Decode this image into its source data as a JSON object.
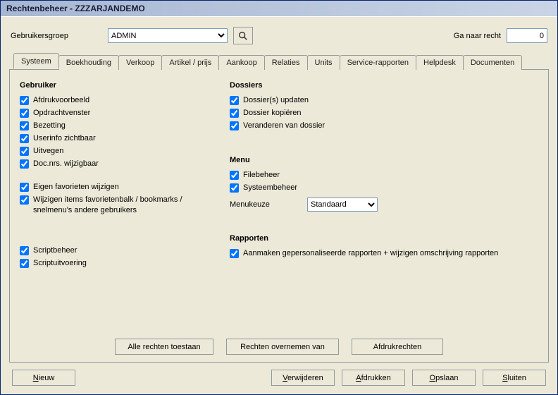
{
  "window": {
    "title": "Rechtenbeheer   -   ZZZARJANDEMO"
  },
  "toolbar": {
    "group_label": "Gebruikersgroep",
    "group_value": "ADMIN",
    "goto_label": "Ga naar recht",
    "goto_value": "0"
  },
  "tabs": [
    {
      "label": "Systeem",
      "active": true
    },
    {
      "label": "Boekhouding"
    },
    {
      "label": "Verkoop"
    },
    {
      "label": "Artikel / prijs"
    },
    {
      "label": "Aankoop"
    },
    {
      "label": "Relaties"
    },
    {
      "label": "Units"
    },
    {
      "label": "Service-rapporten"
    },
    {
      "label": "Helpdesk"
    },
    {
      "label": "Documenten"
    }
  ],
  "panel": {
    "gebruiker": {
      "title": "Gebruiker",
      "items": [
        {
          "label": "Afdrukvoorbeeld",
          "checked": true
        },
        {
          "label": "Opdrachtvenster",
          "checked": true
        },
        {
          "label": "Bezetting",
          "checked": true
        },
        {
          "label": "Userinfo zichtbaar",
          "checked": true
        },
        {
          "label": "Uitvegen",
          "checked": true
        },
        {
          "label": "Doc.nrs. wijzigbaar",
          "checked": true
        }
      ],
      "items2": [
        {
          "label": "Eigen favorieten wijzigen",
          "checked": true
        },
        {
          "label": "Wijzigen items favorietenbalk / bookmarks / snelmenu's andere gebruikers",
          "checked": true
        }
      ],
      "items3": [
        {
          "label": "Scriptbeheer",
          "checked": true
        },
        {
          "label": "Scriptuitvoering",
          "checked": true
        }
      ]
    },
    "dossiers": {
      "title": "Dossiers",
      "items": [
        {
          "label": "Dossier(s) updaten",
          "checked": true
        },
        {
          "label": "Dossier kopiëren",
          "checked": true
        },
        {
          "label": "Veranderen van dossier",
          "checked": true
        }
      ]
    },
    "menu": {
      "title": "Menu",
      "items": [
        {
          "label": "Filebeheer",
          "checked": true
        },
        {
          "label": "Systeembeheer",
          "checked": true
        }
      ],
      "select_label": "Menukeuze",
      "select_value": "Standaard"
    },
    "rapporten": {
      "title": "Rapporten",
      "items": [
        {
          "label": "Aanmaken gepersonaliseerde rapporten + wijzigen omschrijving rapporten",
          "checked": true
        }
      ]
    }
  },
  "mid_buttons": {
    "allow_all": "Alle rechten toestaan",
    "take_from": "Rechten overnemen van",
    "print_rights": "Afdrukrechten"
  },
  "footer": {
    "new": "Nieuw",
    "delete": "Verwijderen",
    "print": "Afdrukken",
    "save": "Opslaan",
    "close": "Sluiten"
  }
}
